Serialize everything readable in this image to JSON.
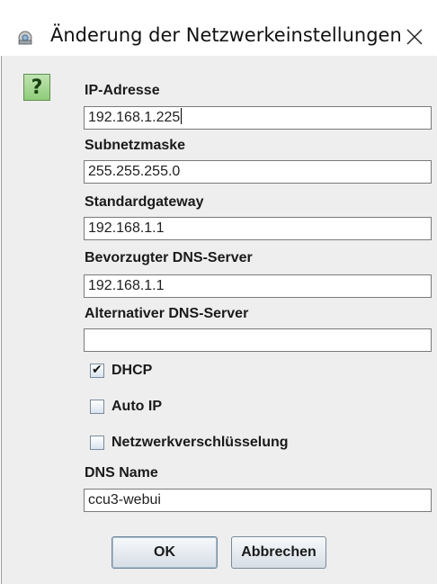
{
  "window": {
    "title": "Änderung der Netzwerkeinstellungen",
    "icon": "network-settings-icon",
    "close_icon": "close-icon"
  },
  "help": {
    "glyph": "?"
  },
  "fields": {
    "ip_address": {
      "label": "IP-Adresse",
      "value": "192.168.1.225"
    },
    "subnet_mask": {
      "label": "Subnetzmaske",
      "value": "255.255.255.0"
    },
    "gateway": {
      "label": "Standardgateway",
      "value": "192.168.1.1"
    },
    "preferred_dns": {
      "label": "Bevorzugter DNS-Server",
      "value": "192.168.1.1"
    },
    "alternate_dns": {
      "label": "Alternativer DNS-Server",
      "value": ""
    },
    "dns_name": {
      "label": "DNS Name",
      "value": "ccu3-webui"
    }
  },
  "checkboxes": {
    "dhcp": {
      "label": "DHCP",
      "checked": true,
      "mark": "✔"
    },
    "auto_ip": {
      "label": "Auto IP",
      "checked": false
    },
    "encryption": {
      "label": "Netzwerkverschlüsselung",
      "checked": false
    }
  },
  "buttons": {
    "ok": "OK",
    "cancel": "Abbrechen"
  }
}
